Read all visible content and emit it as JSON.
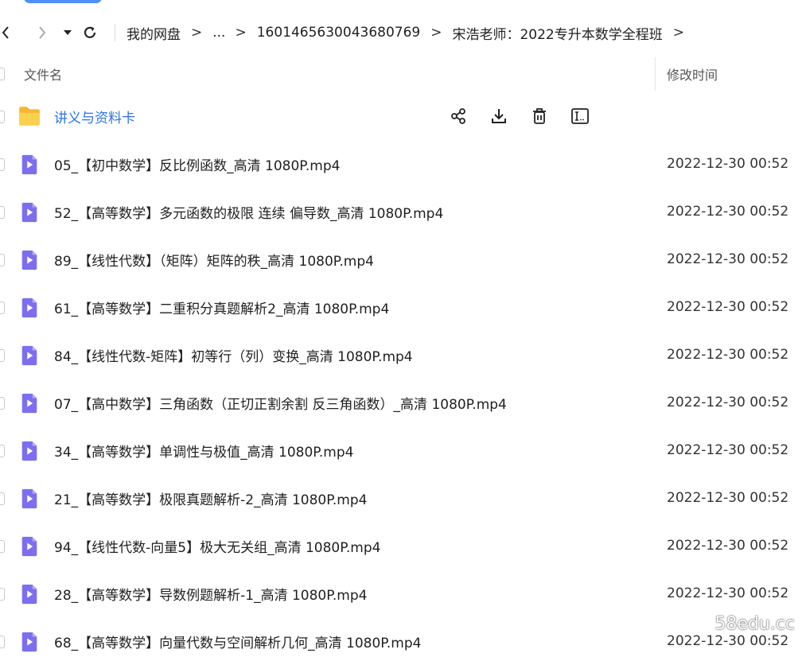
{
  "toolbar": {
    "breadcrumb": [
      {
        "label": "我的网盘"
      },
      {
        "label": "..."
      },
      {
        "label": "1601465630043680769"
      },
      {
        "label": "宋浩老师：2022专升本数学全程班"
      }
    ],
    "separator": ">"
  },
  "table": {
    "columns": {
      "name": "文件名",
      "modified": "修改时间"
    },
    "folder": {
      "name": "讲义与资料卡",
      "icon": "folder-icon",
      "actions": [
        "share-icon",
        "download-icon",
        "delete-icon",
        "more-icon"
      ]
    },
    "files": [
      {
        "name": "05_【初中数学】反比例函数_高清 1080P.mp4",
        "modified": "2022-12-30 00:52"
      },
      {
        "name": "52_【高等数学】多元函数的极限 连续 偏导数_高清 1080P.mp4",
        "modified": "2022-12-30 00:52"
      },
      {
        "name": "89_【线性代数】（矩阵）矩阵的秩_高清 1080P.mp4",
        "modified": "2022-12-30 00:52"
      },
      {
        "name": "61_【高等数学】二重积分真题解析2_高清 1080P.mp4",
        "modified": "2022-12-30 00:52"
      },
      {
        "name": "84_【线性代数-矩阵】初等行（列）变换_高清 1080P.mp4",
        "modified": "2022-12-30 00:52"
      },
      {
        "name": "07_【高中数学】三角函数（正切正割余割 反三角函数）_高清 1080P.mp4",
        "modified": "2022-12-30 00:52"
      },
      {
        "name": "34_【高等数学】单调性与极值_高清 1080P.mp4",
        "modified": "2022-12-30 00:52"
      },
      {
        "name": "21_【高等数学】极限真题解析-2_高清 1080P.mp4",
        "modified": "2022-12-30 00:52"
      },
      {
        "name": "94_【线性代数-向量5】极大无关组_高清 1080P.mp4",
        "modified": "2022-12-30 00:52"
      },
      {
        "name": "28_【高等数学】导数例题解析-1_高清 1080P.mp4",
        "modified": "2022-12-30 00:52"
      },
      {
        "name": "68_【高等数学】向量代数与空间解析几何_高清 1080P.mp4",
        "modified": "2022-12-30 00:52"
      }
    ],
    "file_icon": "video-file-icon"
  },
  "watermark": "58edu.cc",
  "colors": {
    "accent": "#2a73e8",
    "folder": "#f7c13a",
    "video_icon": "#7b6ff0"
  }
}
